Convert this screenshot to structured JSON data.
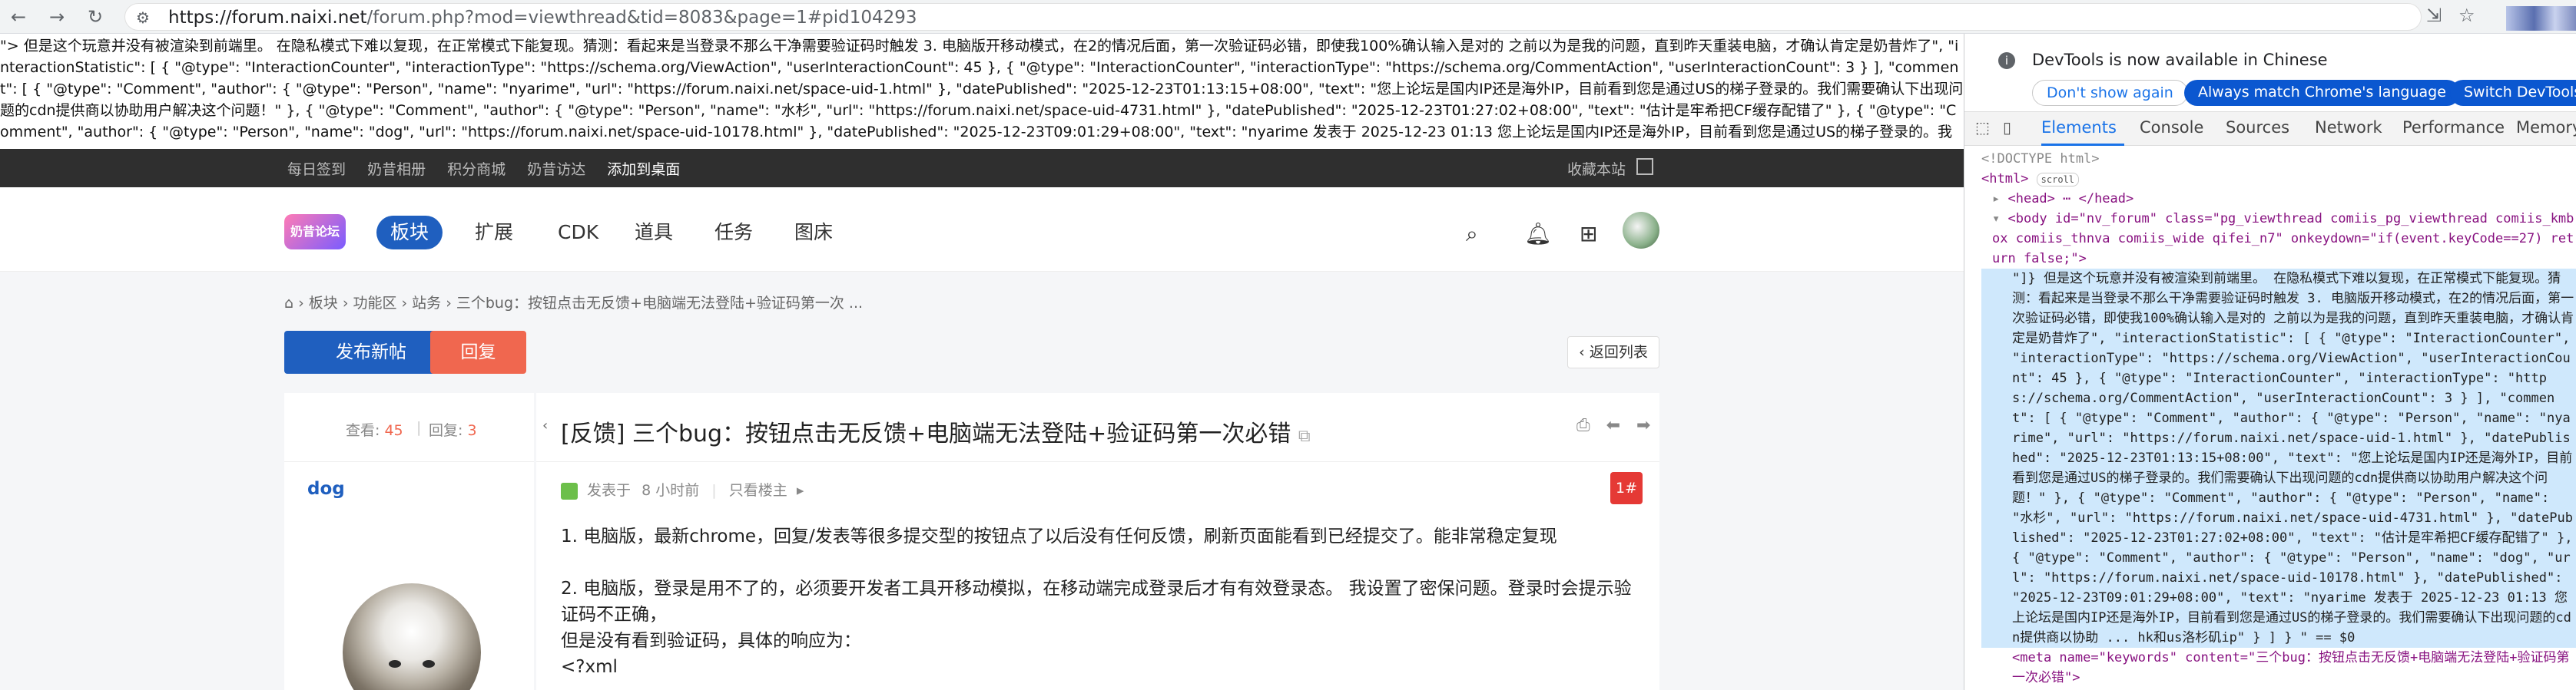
{
  "browser": {
    "url": "https://forum.naixi.net/forum.php?mod=viewthread&tid=8083&page=1#pid104293",
    "url_host": "https://forum.naixi.net",
    "url_path": "/forum.php?mod=viewthread&tid=8083&page=1#pid104293",
    "back_icon": "back-arrow-icon",
    "forward_icon": "forward-arrow-icon",
    "reload_icon": "reload-icon"
  },
  "page": {
    "raw_text": "\"> 但是这个玩意并没有被渲染到前端里。 在隐私模式下难以复现，在正常模式下能复现。猜测：看起来是当登录不那么干净需要验证码时触发 3. 电脑版开移动模式，在2的情况后面，第一次验证码必错，即使我100%确认输入是对的 之前以为是我的问题，直到昨天重装电脑，才确认肯定是奶昔炸了\", \"interactionStatistic\": [ { \"@type\": \"InteractionCounter\", \"interactionType\": \"https://schema.org/ViewAction\", \"userInteractionCount\": 45 }, { \"@type\": \"InteractionCounter\", \"interactionType\": \"https://schema.org/CommentAction\", \"userInteractionCount\": 3 } ], \"comment\": [ { \"@type\": \"Comment\", \"author\": { \"@type\": \"Person\", \"name\": \"nyarime\", \"url\": \"https://forum.naixi.net/space-uid-1.html\" }, \"datePublished\": \"2025-12-23T01:13:15+08:00\", \"text\": \"您上论坛是国内IP还是海外IP，目前看到您是通过US的梯子登录的。我们需要确认下出现问题的cdn提供商以协助用户解决这个问题！\" }, { \"@type\": \"Comment\", \"author\": { \"@type\": \"Person\", \"name\": \"水杉\", \"url\": \"https://forum.naixi.net/space-uid-4731.html\" }, \"datePublished\": \"2025-12-23T01:27:02+08:00\", \"text\": \"估计是牢希把CF缓存配错了\" }, { \"@type\": \"Comment\", \"author\": { \"@type\": \"Person\", \"name\": \"dog\", \"url\": \"https://forum.naixi.net/space-uid-10178.html\" }, \"datePublished\": \"2025-12-23T09:01:29+08:00\", \"text\": \"nyarime 发表于 2025-12-23 01:13 您上论坛是国内IP还是海外IP，目前看到您是通过US的梯子登录的。我们需要确认下出现问题的cdn提供商以协助 ... hk和us洛杉矶ip\" } ] }",
    "topbar": {
      "links": [
        "每日签到",
        "奶昔相册",
        "积分商城",
        "奶昔访达",
        "添加到桌面"
      ],
      "favorite": "收藏本站"
    },
    "header": {
      "logo_text": "奶昔论坛",
      "nav": [
        "板块",
        "扩展",
        "CDK",
        "道具",
        "任务",
        "图床"
      ],
      "search_icon": "search-icon",
      "bell_icon": "bell-icon",
      "apps_icon": "apps-grid-icon"
    },
    "breadcrumb": {
      "items": [
        "板块",
        "功能区",
        "站务",
        "三个bug：按钮点击无反馈+电脑端无法登陆+验证码第一次 ..."
      ]
    },
    "actions": {
      "new_post": "发布新帖",
      "reply": "回复",
      "back_to_list": "返回列表"
    },
    "thread": {
      "views_label": "查看:",
      "views": "45",
      "replies_label": "回复:",
      "replies": "3",
      "title": "[反馈] 三个bug：按钮点击无反馈+电脑端无法登陆+验证码第一次必错",
      "author": "dog",
      "posted_label": "发表于",
      "posted_time": "8 小时前",
      "only_author": "只看楼主",
      "floor": "1#",
      "body": [
        "1. 电脑版，最新chrome，回复/发表等很多提交型的按钮点了以后没有任何反馈，刷新页面能看到已经提交了。能非常稳定复现",
        "2. 电脑版，登录是用不了的，必须要开发者工具开移动模拟，在移动端完成登录后才有有效登录态。 我设置了密保问题。登录时会提示验证码不正确，",
        "但是没有看到验证码，具体的响应为：",
        "<?xml"
      ]
    }
  },
  "devtools": {
    "notice": "DevTools is now available in Chinese",
    "dont_show": "Don't show again",
    "match_lang": "Always match Chrome's language",
    "switch": "Switch DevTools t",
    "tabs": [
      "Elements",
      "Console",
      "Sources",
      "Network",
      "Performance",
      "Memory"
    ],
    "dom": {
      "doctype": "<!DOCTYPE html>",
      "html_open": "<html>",
      "scroll_badge": "scroll",
      "head": "<head> ⋯ </head>",
      "body_open": "<body id=\"nv_forum\" class=\"pg_viewthread comiis_pg_viewthread comiis_kmbox comiis_thnva comiis_wide qifei_n7\" onkeydown=\"if(event.keyCode==27) return false;\">",
      "text_node": "\"]} 但是这个玩意并没有被渲染到前端里。 在隐私模式下难以复现，在正常模式下能复现。猜测：看起来是当登录不那么干净需要验证码时触发 3. 电脑版开移动模式，在2的情况后面，第一次验证码必错，即使我100%确认输入是对的 之前以为是我的问题，直到昨天重装电脑，才确认肯定是奶昔炸了\", \"interactionStatistic\": [ { \"@type\": \"InteractionCounter\", \"interactionType\": \"https://schema.org/ViewAction\", \"userInteractionCount\": 45 }, { \"@type\": \"InteractionCounter\", \"interactionType\": \"https://schema.org/CommentAction\", \"userInteractionCount\": 3 } ], \"comment\": [ { \"@type\": \"Comment\", \"author\": { \"@type\": \"Person\", \"name\": \"nyarime\", \"url\": \"https://forum.naixi.net/space-uid-1.html\" }, \"datePublished\": \"2025-12-23T01:13:15+08:00\", \"text\": \"您上论坛是国内IP还是海外IP，目前看到您是通过US的梯子登录的。我们需要确认下出现问题的cdn提供商以协助用户解决这个问题！\" }, { \"@type\": \"Comment\", \"author\": { \"@type\": \"Person\", \"name\": \"水杉\", \"url\": \"https://forum.naixi.net/space-uid-4731.html\" }, \"datePublished\": \"2025-12-23T01:27:02+08:00\", \"text\": \"估计是牢希把CF缓存配错了\" }, { \"@type\": \"Comment\", \"author\": { \"@type\": \"Person\", \"name\": \"dog\", \"url\": \"https://forum.naixi.net/space-uid-10178.html\" }, \"datePublished\": \"2025-12-23T09:01:29+08:00\", \"text\": \"nyarime 发表于 2025-12-23 01:13 您上论坛是国内IP还是海外IP，目前看到您是通过US的梯子登录的。我们需要确认下出现问题的cdn提供商以协助 ... hk和us洛杉矶ip\" } ] } \" == $0",
      "meta_line": "<meta name=\"keywords\" content=\"三个bug：按钮点击无反馈+电脑端无法登陆+验证码第一次必错\">"
    }
  },
  "colors": {
    "accent": "#1f5fbf",
    "reply": "#f0674f",
    "devtools_link": "#1a73e8"
  }
}
